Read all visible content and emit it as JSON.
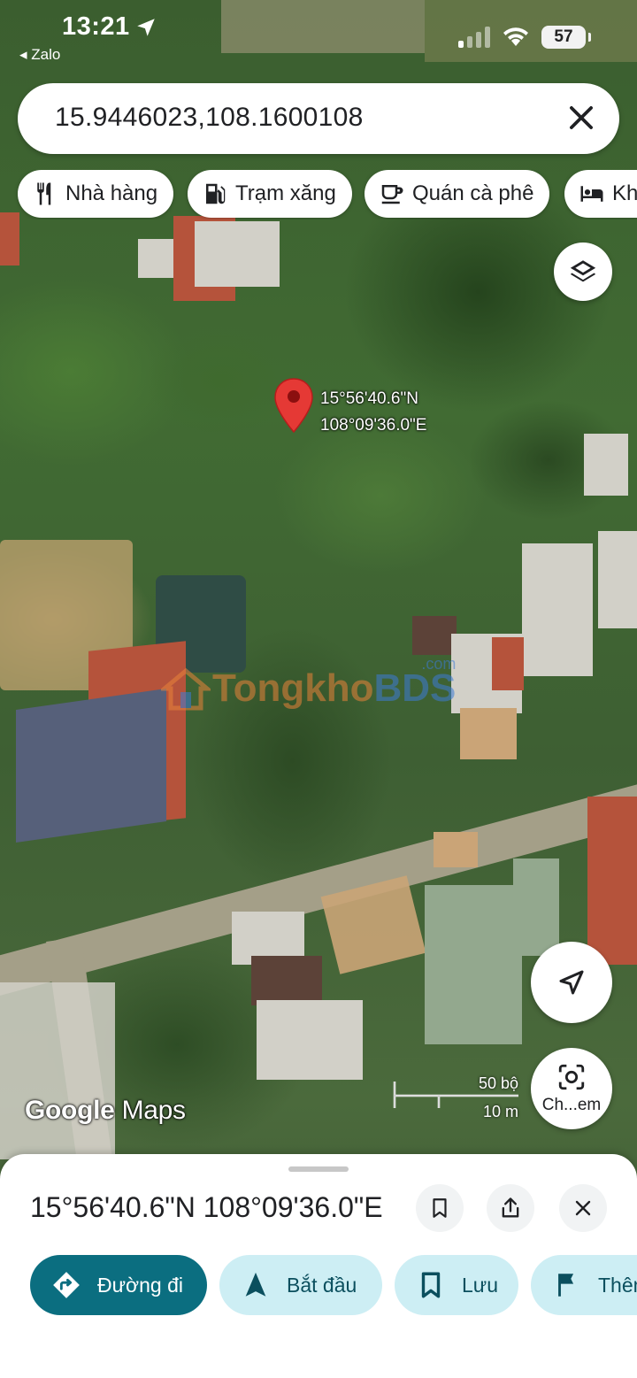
{
  "status_bar": {
    "time": "13:21",
    "back_app": "◂ Zalo",
    "battery": "57"
  },
  "search": {
    "value": "15.9446023,108.1600108"
  },
  "chips": [
    {
      "label": "Nhà hàng",
      "icon": "restaurant-icon"
    },
    {
      "label": "Trạm xăng",
      "icon": "gas-station-icon"
    },
    {
      "label": "Quán cà phê",
      "icon": "coffee-icon"
    },
    {
      "label": "Khách sạn",
      "icon": "hotel-icon"
    }
  ],
  "map": {
    "pin_lat": "15°56'40.6\"N",
    "pin_lng": "108°09'36.0\"E",
    "watermark_brand_1": "Tongkho",
    "watermark_brand_2": "BDS",
    "watermark_domain": ".com",
    "logo_google": "Google",
    "logo_maps": "Maps",
    "scale_imperial": "50 bộ",
    "scale_metric": "10 m",
    "lens_label": "Ch...em"
  },
  "sheet": {
    "title": "15°56'40.6\"N 108°09'36.0\"E",
    "actions": {
      "directions": "Đường đi",
      "start": "Bắt đầu",
      "save": "Lưu",
      "more": "Thêm"
    }
  },
  "colors": {
    "primary": "#0b6e80",
    "secondary": "#cdeef4",
    "pin": "#e53935"
  }
}
